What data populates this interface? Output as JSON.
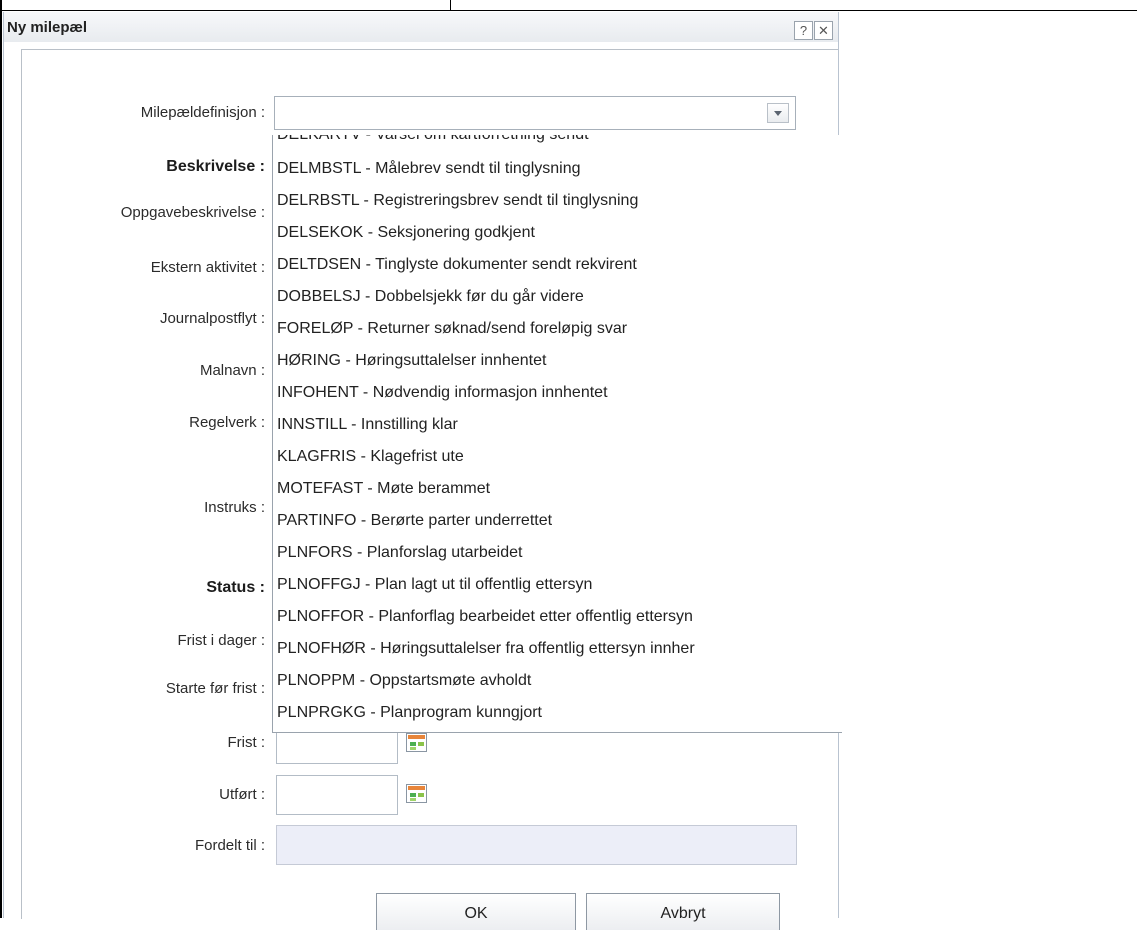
{
  "dialog": {
    "title": "Ny milepæl",
    "help_glyph": "?",
    "close_glyph": "✕"
  },
  "form": {
    "labels": {
      "milepaeldefinisjon": "Milepældefinisjon :",
      "beskrivelse": "Beskrivelse :",
      "oppgavebeskrivelse": "Oppgavebeskrivelse :",
      "ekstern_aktivitet": "Ekstern aktivitet :",
      "journalpostflyt": "Journalpostflyt :",
      "malnavn": "Malnavn :",
      "regelverk": "Regelverk :",
      "instruks": "Instruks :",
      "status": "Status :",
      "frist_i_dager": "Frist i dager :",
      "starte_for_frist": "Starte før frist :",
      "frist": "Frist :",
      "utfort": "Utført :",
      "fordelt_til": "Fordelt til :"
    },
    "milepaeldefinisjon_value": "",
    "fordelt_til_value": ""
  },
  "dropdown": {
    "partial_top": "DELKARTV - Varsel om kartforretning sendt",
    "items": [
      "DELMBSTL - Målebrev sendt til tinglysning",
      "DELRBSTL - Registreringsbrev sendt til tinglysning",
      "DELSEKOK - Seksjonering godkjent",
      "DELTDSEN - Tinglyste dokumenter sendt rekvirent",
      "DOBBELSJ - Dobbelsjekk før du går videre",
      "FORELØP - Returner søknad/send foreløpig svar",
      "HØRING - Høringsuttalelser innhentet",
      "INFOHENT - Nødvendig informasjon innhentet",
      "INNSTILL - Innstilling klar",
      "KLAGFRIS - Klagefrist ute",
      "MOTEFAST - Møte berammet",
      "PARTINFO - Berørte parter underrettet",
      "PLNFORS - Planforslag utarbeidet",
      "PLNOFFGJ - Plan lagt ut til offentlig ettersyn",
      "PLNOFFOR - Planforflag bearbeidet etter offentlig ettersyn",
      "PLNOFHØR - Høringsuttalelser fra offentlig ettersyn innher",
      "PLNOPPM - Oppstartsmøte avholdt",
      "PLNPRGKG - Planprogram kunngjort"
    ]
  },
  "buttons": {
    "ok": "OK",
    "cancel": "Avbryt"
  }
}
